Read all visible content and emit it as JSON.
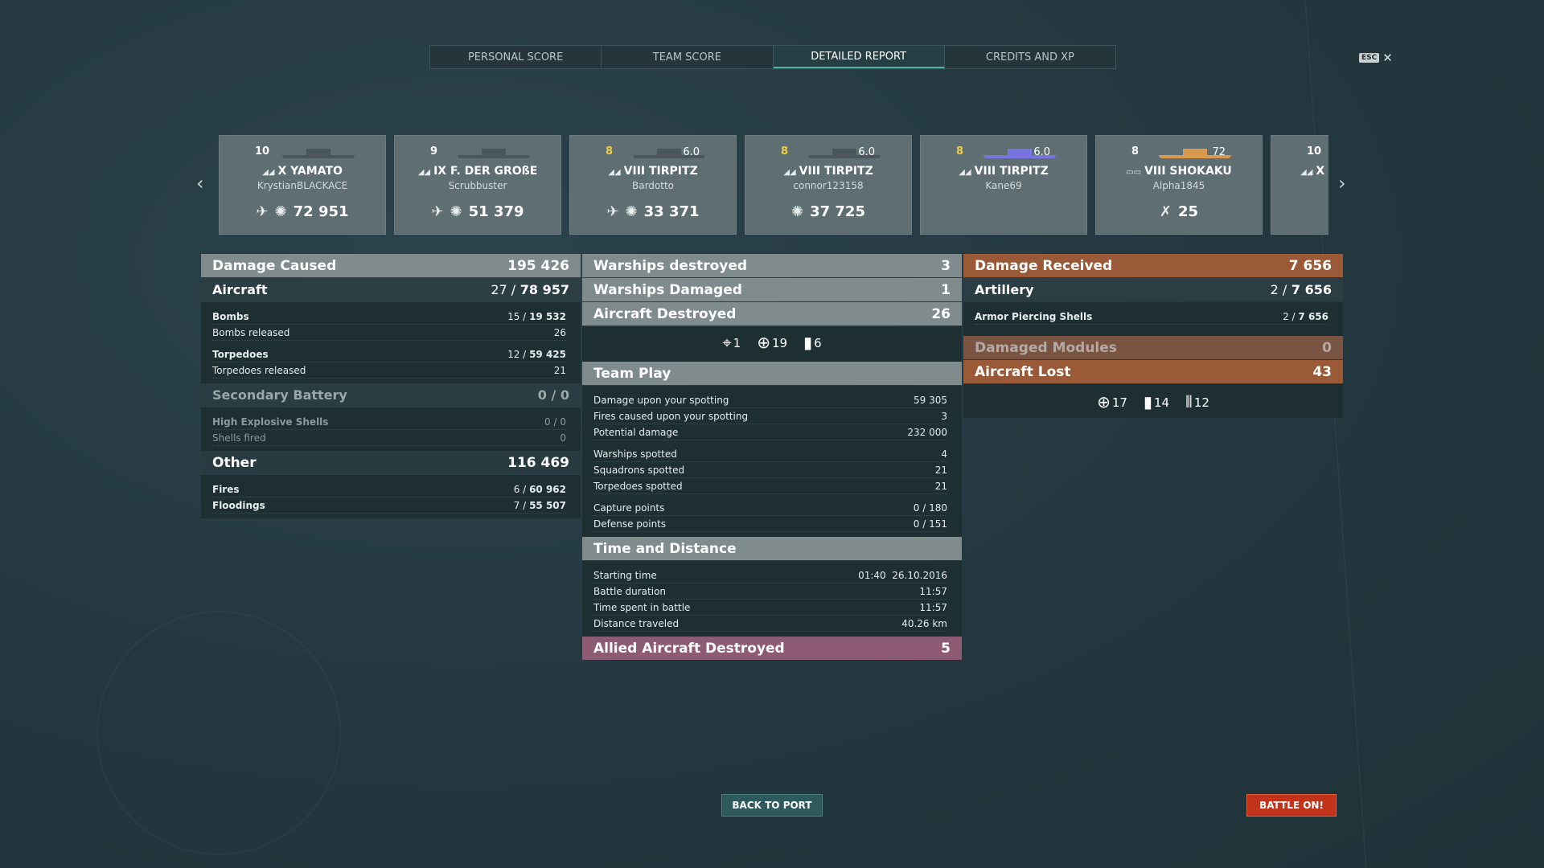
{
  "tabs": [
    "PERSONAL SCORE",
    "TEAM SCORE",
    "DETAILED REPORT",
    "CREDITS AND XP"
  ],
  "esc": {
    "key": "ESC",
    "close": "✕"
  },
  "nav": {
    "prev": "‹",
    "next": "›"
  },
  "ships": [
    {
      "tier": "10",
      "name": "X YAMATO",
      "player": "KrystianBLACKACE",
      "mm": "",
      "score": "72 951",
      "cls_icon": "battleship-icon",
      "score_icons": [
        "torpedo-plane-icon",
        "damage-burst-icon"
      ],
      "color": "gray"
    },
    {
      "tier": "9",
      "name": "IX F. DER GROßE",
      "player": "Scrubbuster",
      "mm": "",
      "score": "51 379",
      "cls_icon": "battleship-icon",
      "score_icons": [
        "torpedo-plane-icon",
        "damage-burst-icon"
      ],
      "color": "gray"
    },
    {
      "tier": "8",
      "name": "VIII TIRPITZ",
      "player": "Bardotto",
      "mm": "6.0",
      "score": "33 371",
      "cls_icon": "battleship-icon",
      "score_icons": [
        "torpedo-plane-icon",
        "damage-burst-icon"
      ],
      "color": "gray",
      "premium": true
    },
    {
      "tier": "8",
      "name": "VIII TIRPITZ",
      "player": "connor123158",
      "mm": "6.0",
      "score": "37 725",
      "cls_icon": "battleship-icon",
      "score_icons": [
        "damage-burst-icon"
      ],
      "color": "gray",
      "premium": true
    },
    {
      "tier": "8",
      "name": "VIII TIRPITZ",
      "player": "Kane69",
      "mm": "6.0",
      "score": "",
      "cls_icon": "battleship-icon",
      "score_icons": [],
      "color": "purple",
      "premium": true
    },
    {
      "tier": "8",
      "name": "VIII SHOKAKU",
      "player": "Alpha1845",
      "mm": "72",
      "score": "25",
      "cls_icon": "carrier-icon",
      "score_icons": [
        "planes-destroyed-icon"
      ],
      "color": "orange"
    },
    {
      "tier": "10",
      "name": "X",
      "player": "",
      "mm": "",
      "score": "",
      "cls_icon": "battleship-icon",
      "score_icons": [],
      "color": "gray"
    }
  ],
  "left": {
    "damage_caused": {
      "label": "Damage Caused",
      "value": "195 426"
    },
    "aircraft": {
      "label": "Aircraft",
      "hits": "27 /",
      "dmg": "78 957"
    },
    "bombs": {
      "label": "Bombs",
      "hits": "15 /",
      "dmg": "19 532"
    },
    "bombs_released": {
      "label": "Bombs released",
      "value": "26"
    },
    "torpedoes": {
      "label": "Torpedoes",
      "hits": "12 /",
      "dmg": "59 425"
    },
    "torpedoes_released": {
      "label": "Torpedoes released",
      "value": "21"
    },
    "secondary": {
      "label": "Secondary Battery",
      "value": "0 / 0"
    },
    "he_shells": {
      "label": "High Explosive Shells",
      "value": "0 / 0"
    },
    "shells_fired": {
      "label": "Shells fired",
      "value": "0"
    },
    "other": {
      "label": "Other",
      "value": "116 469"
    },
    "fires": {
      "label": "Fires",
      "hits": "6 /",
      "dmg": "60 962"
    },
    "floodings": {
      "label": "Floodings",
      "hits": "7 /",
      "dmg": "55 507"
    }
  },
  "mid": {
    "warships_destroyed": {
      "label": "Warships destroyed",
      "value": "3"
    },
    "warships_damaged": {
      "label": "Warships Damaged",
      "value": "1"
    },
    "aircraft_destroyed": {
      "label": "Aircraft Destroyed",
      "value": "26"
    },
    "aircraft_icons": [
      {
        "icon": "fighter-crosshair-icon",
        "value": "1"
      },
      {
        "icon": "torpedo-bomber-crosshair-icon",
        "value": "19"
      },
      {
        "icon": "bomb-icon",
        "value": "6"
      }
    ],
    "team_play": {
      "label": "Team Play"
    },
    "tp_rows": [
      {
        "label": "Damage upon your spotting",
        "value": "59 305"
      },
      {
        "label": "Fires caused upon your spotting",
        "value": "3"
      },
      {
        "label": "Potential damage",
        "value": "232 000"
      },
      {
        "label": "Warships spotted",
        "value": "4"
      },
      {
        "label": "Squadrons spotted",
        "value": "21"
      },
      {
        "label": "Torpedoes spotted",
        "value": "21"
      },
      {
        "label": "Capture points",
        "value": "0 / 180"
      },
      {
        "label": "Defense points",
        "value": "0 / 151"
      }
    ],
    "time_distance": {
      "label": "Time and Distance"
    },
    "td_rows": [
      {
        "label": "Starting time",
        "value": "01:40  26.10.2016"
      },
      {
        "label": "Battle duration",
        "value": "11:57"
      },
      {
        "label": "Time spent in battle",
        "value": "11:57"
      },
      {
        "label": "Distance traveled",
        "value": "40.26 km"
      }
    ],
    "allied": {
      "label": "Allied Aircraft Destroyed",
      "value": "5"
    }
  },
  "right": {
    "damage_received": {
      "label": "Damage Received",
      "value": "7 656"
    },
    "artillery": {
      "label": "Artillery",
      "hits": "2 /",
      "dmg": "7 656"
    },
    "ap_shells": {
      "label": "Armor Piercing Shells",
      "hits": "2 /",
      "dmg": "7 656"
    },
    "damaged_modules": {
      "label": "Damaged Modules",
      "value": "0"
    },
    "aircraft_lost": {
      "label": "Aircraft Lost",
      "value": "43"
    },
    "lost_icons": [
      {
        "icon": "fighter-crosshair-icon",
        "value": "17"
      },
      {
        "icon": "bomb-icon",
        "value": "14"
      },
      {
        "icon": "torpedo-icon",
        "value": "12"
      }
    ]
  },
  "buttons": {
    "back": "BACK TO PORT",
    "battle": "BATTLE ON!"
  },
  "colors": {
    "active_tab": "#4fb3a6",
    "received": "#9a5a38",
    "allied": "#8d5c74",
    "battle_button": "#c2331b"
  }
}
